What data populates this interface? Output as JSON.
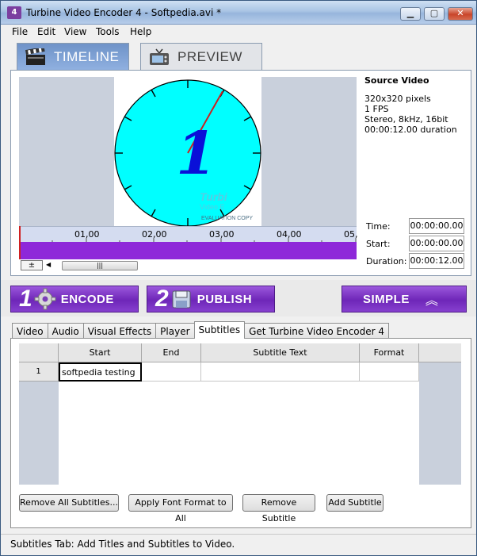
{
  "window": {
    "title": "Turbine Video Encoder 4 - Softpedia.avi *",
    "app_icon_text": "4",
    "minimize": "▁",
    "maximize": "▢",
    "close": "✕"
  },
  "menu": [
    "File",
    "Edit",
    "View",
    "Tools",
    "Help"
  ],
  "big_tabs": {
    "timeline": "TIMELINE",
    "preview": "PREVIEW"
  },
  "video": {
    "clock_digit": "1",
    "watermark_1": "Turbi",
    "watermark_2": "Video E",
    "watermark_3": "EVALUATION COPY"
  },
  "timeline": {
    "ticks": [
      "01,00",
      "02,00",
      "03,00",
      "04,00",
      "05,"
    ],
    "zoom_button": "±",
    "scroll_left": "◀",
    "scroll_right": "▶",
    "thumb_grip": "|||"
  },
  "source_info": {
    "heading": "Source Video",
    "resolution": "320x320 pixels",
    "fps": "1 FPS",
    "audio": "Stereo, 8kHz, 16bit",
    "duration": "00:00:12.00 duration"
  },
  "fields": {
    "time_label": "Time:",
    "time_value": "00:00:00.00",
    "start_label": "Start:",
    "start_value": "00:00:00.00",
    "duration_label": "Duration:",
    "duration_value": "00:00:12.00"
  },
  "actions": {
    "encode_num": "1",
    "encode_label": "ENCODE",
    "publish_num": "2",
    "publish_label": "PUBLISH",
    "simple_label": "SIMPLE",
    "simple_icon": "︽"
  },
  "sub_tabs": [
    "Video",
    "Audio",
    "Visual Effects",
    "Player",
    "Subtitles",
    "Get Turbine Video Encoder 4"
  ],
  "sub_tab_active": "Subtitles",
  "subtitle_grid": {
    "columns": [
      "Start",
      "End",
      "Subtitle Text",
      "Format"
    ],
    "rows": [
      {
        "num": "1",
        "start": "softpedia testing",
        "end": "",
        "text": "",
        "format": ""
      }
    ]
  },
  "buttons": {
    "remove_all": "Remove All Subtitles...",
    "apply_font": "Apply Font Format to All",
    "remove": "Remove Subtitle",
    "add": "Add Subtitle"
  },
  "status": "Subtitles Tab: Add Titles and Subtitles to Video.",
  "colors": {
    "accent_purple": "#8e28d9",
    "clock_face": "#00ffff",
    "clock_digit": "#0a10d8"
  }
}
